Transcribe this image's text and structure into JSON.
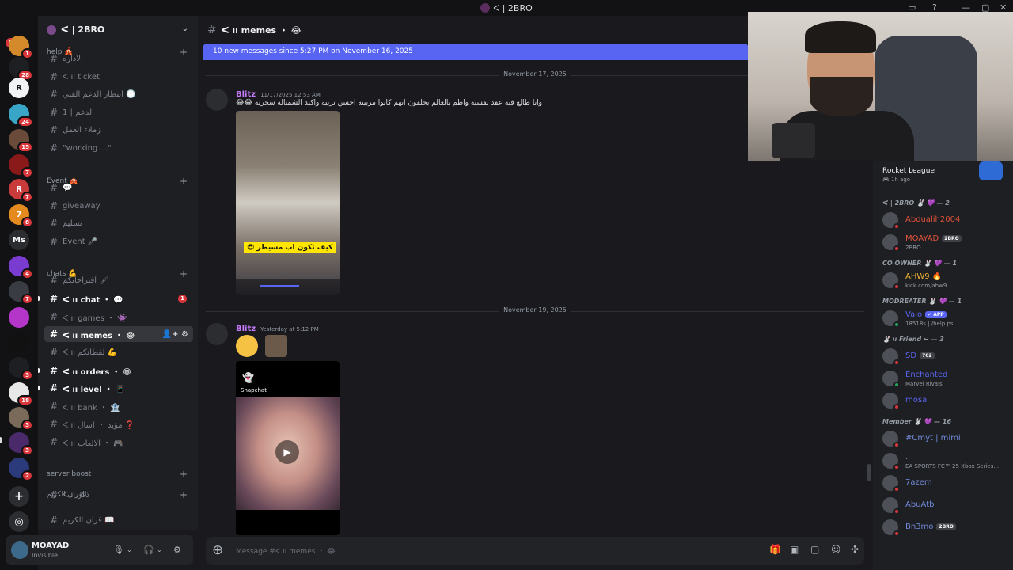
{
  "window": {
    "title": "ᐸ | 2BRO"
  },
  "rail": {
    "new_label": "NEW",
    "servers": [
      {
        "glyph": "",
        "badge": "1",
        "color": "#d48a2a"
      },
      {
        "glyph": "",
        "badge": "28",
        "color": "#1e1f22"
      },
      {
        "glyph": "R",
        "badge": "",
        "color": "#f2f3f5"
      },
      {
        "glyph": "",
        "badge": "24",
        "color": "#3aa6c7"
      },
      {
        "glyph": "",
        "badge": "15",
        "color": "#6a4b3a"
      },
      {
        "glyph": "",
        "badge": "7",
        "color": "#8a1a1a"
      },
      {
        "glyph": "R",
        "badge": "7",
        "color": "#c93a3a"
      },
      {
        "glyph": "7",
        "badge": "8",
        "color": "#e58a1f"
      },
      {
        "glyph": "Ms",
        "badge": "",
        "color": "#2b2d31"
      },
      {
        "glyph": "",
        "badge": "4",
        "color": "#7a3bd1"
      },
      {
        "glyph": "",
        "badge": "7",
        "color": "#3a3c44"
      },
      {
        "glyph": "",
        "badge": "",
        "color": "#b436c9"
      },
      {
        "glyph": "",
        "badge": "",
        "color": "#111111"
      },
      {
        "glyph": "",
        "badge": "3",
        "color": "#1e1f22"
      },
      {
        "glyph": "",
        "badge": "18",
        "color": "#e8e8e8"
      },
      {
        "glyph": "",
        "badge": "3",
        "color": "#7a6a5a"
      },
      {
        "glyph": "",
        "badge": "3",
        "color": "#4a2a6a"
      },
      {
        "glyph": "",
        "badge": "2",
        "color": "#2a3a7a"
      }
    ],
    "add_glyph": "+",
    "discover_glyph": "◎"
  },
  "sidebar": {
    "guild_name": "ᐸ | 2BRO",
    "categories": {
      "help": "help 🎪",
      "event": "Event 🎪",
      "chats": "chats 💪",
      "boost": "server boost",
      "quran": "القران الكريم"
    },
    "channels": [
      {
        "name": "الاداره",
        "state": "muted"
      },
      {
        "name": "ᐸ ıı ticket",
        "state": "muted"
      },
      {
        "name": "انتظار الدعم الفني 🕐",
        "state": "muted"
      },
      {
        "name": "الدعم | 1",
        "state": "muted"
      },
      {
        "name": "زملاء العمل",
        "state": "muted"
      },
      {
        "name": "\"working ...\"",
        "state": "muted"
      },
      {
        "name": "💬",
        "state": "muted"
      },
      {
        "name": "giveaway",
        "state": "muted"
      },
      {
        "name": "تسليم",
        "state": "muted"
      },
      {
        "name": "Event 🎤",
        "state": "muted"
      },
      {
        "name": "اقتراحاتكم 🖌",
        "state": "muted"
      },
      {
        "name": "ᐸ ıı chat ・ 💬",
        "state": "unread",
        "mention": "1"
      },
      {
        "name": "ᐸ ıı games ・ 👾",
        "state": "muted"
      },
      {
        "name": "ᐸ ıı memes ・ 😂",
        "state": "active"
      },
      {
        "name": "ᐸ ıı لقطاتكم 💪",
        "state": "muted"
      },
      {
        "name": "ᐸ ıı orders ・ 😁",
        "state": "unread"
      },
      {
        "name": "ᐸ ıı level ・ 📱",
        "state": "unread"
      },
      {
        "name": "ᐸ ıı bank ・ 🏦",
        "state": "muted"
      },
      {
        "name": "ᐸ ıı مؤيد ・ اسال ❓",
        "state": "muted"
      },
      {
        "name": "ᐸ ıı الالعاب ・ 🎮",
        "state": "muted"
      },
      {
        "name": "ᐸ ıı ذكر",
        "state": "muted"
      },
      {
        "name": "قران الكريم 📖",
        "state": "muted"
      }
    ]
  },
  "user": {
    "name": "MOAYAD",
    "status": "Invisible"
  },
  "chat": {
    "channel_name": "ᐸ ıı memes ・ 😂",
    "new_messages_bar": "10 new messages since 5:27 PM on November 16, 2025",
    "messages": [
      {
        "date_divider": "November 17, 2025",
        "author": "Blitz",
        "timestamp": "11/17/2025 12:53 AM",
        "text": "وانا طالع فيه عقد نفسيه واظم بالعالم يحلفون انهم كانوا مربينه احسن تربيه واكيد الشمتاله سحرته 😂😂",
        "caption": "كيف تكون اب مسيطر 😎"
      },
      {
        "date_divider": "November 19, 2025",
        "author": "Blitz",
        "timestamp": "Yesterday at 5:12 PM",
        "snapchat_label": "Snapchat"
      }
    ],
    "composer_placeholder": "Message #ᐸ ıı memes ・ 😂"
  },
  "members": {
    "activity": {
      "game": "Rocket League",
      "time": "1h ago"
    },
    "groups": [
      {
        "label": "ᐸ | 2BRO 🐰 💜 — 2",
        "members": [
          {
            "name": "Abdualih2004",
            "sub": "",
            "color": "#e0523c",
            "online": false
          },
          {
            "name": "MOAYAD",
            "sub": "2BRO",
            "color": "#e0523c",
            "online": false,
            "tag": "2BRO"
          }
        ]
      },
      {
        "label": "CO OWNER 🐰 💜 — 1",
        "members": [
          {
            "name": "AHW9 🔥",
            "sub": "kick.com/ahw9",
            "color": "#f0b232",
            "online": false
          }
        ]
      },
      {
        "label": "MODREATER 🐰 💜 — 1",
        "members": [
          {
            "name": "Valo",
            "sub": "18518s | /help ps",
            "color": "#5865f2",
            "online": true,
            "tag": "✓ APP"
          }
        ]
      },
      {
        "label": "🐰 ıı Friend ↩ — 3",
        "members": [
          {
            "name": "SD",
            "sub": "",
            "color": "#5865f2",
            "online": false,
            "tag": "702"
          },
          {
            "name": "Enchanted",
            "sub": "Marvel Rivals",
            "color": "#5865f2",
            "online": true
          },
          {
            "name": "mosa",
            "sub": "",
            "color": "#5865f2",
            "online": false
          }
        ]
      },
      {
        "label": "Member 🐰 💜 — 16",
        "members": [
          {
            "name": "#Cmyt | mimi",
            "sub": "",
            "color": "#7289da",
            "online": false
          },
          {
            "name": ".",
            "sub": "EA SPORTS FC™ 25 Xbox Series...",
            "color": "#7289da",
            "online": false
          },
          {
            "name": "7azem",
            "sub": "",
            "color": "#7289da",
            "online": false
          },
          {
            "name": "AbuAtb",
            "sub": "",
            "color": "#7289da",
            "online": false
          },
          {
            "name": "Bn3mo",
            "sub": "",
            "color": "#7289da",
            "online": false,
            "tag": "2BRO"
          }
        ]
      }
    ]
  }
}
